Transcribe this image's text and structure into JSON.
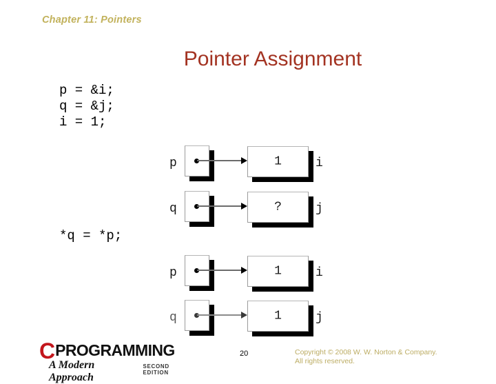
{
  "slide": {
    "header": "Chapter 11: Pointers",
    "title": "Pointer Assignment",
    "code_before": "p = &i;\nq = &j;\ni = 1;",
    "code_after": "*q = *p;"
  },
  "colors": {
    "header": "#C2B25C",
    "title": "#A33322",
    "copyright": "#BCAC63",
    "logo_c": "#C3161C",
    "box_shadow": "#000000"
  },
  "diagrams": [
    {
      "name": "before-assignment",
      "rows": [
        {
          "pointer_label": "p",
          "pointer_value": "",
          "value": "1",
          "value_label": "i",
          "dim": false
        },
        {
          "pointer_label": "q",
          "pointer_value": "",
          "value": "?",
          "value_label": "j",
          "dim": false
        }
      ]
    },
    {
      "name": "after-assignment",
      "rows": [
        {
          "pointer_label": "p",
          "pointer_value": "",
          "value": "1",
          "value_label": "i",
          "dim": false
        },
        {
          "pointer_label": "q",
          "pointer_value": "",
          "value": "1",
          "value_label": "j",
          "dim": true
        }
      ]
    }
  ],
  "footer": {
    "logo_c": "C",
    "logo_programming": "PROGRAMMING",
    "logo_subtitle": "A Modern Approach",
    "logo_edition": "Second Edition",
    "page_number": "20",
    "copyright_line1": "Copyright © 2008 W. W. Norton & Company.",
    "copyright_line2": "All rights reserved."
  }
}
